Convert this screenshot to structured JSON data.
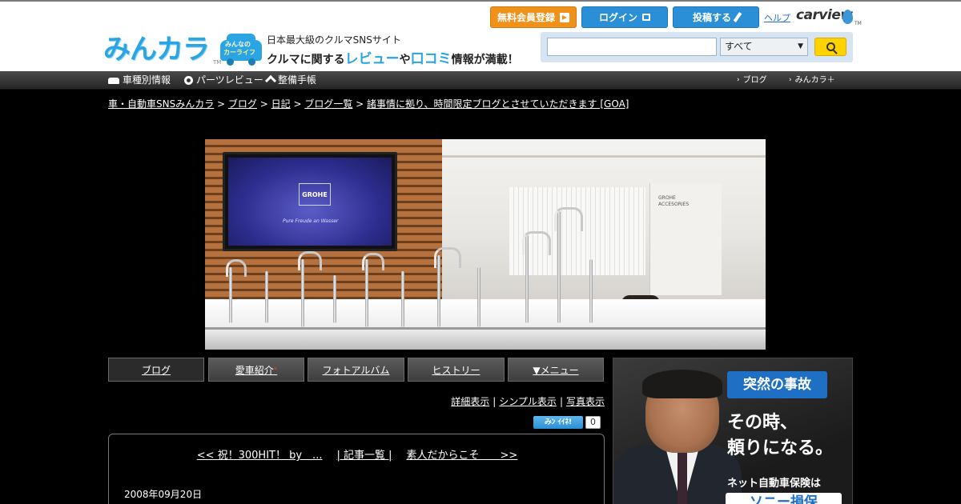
{
  "header": {
    "logo_text": "みんカラ",
    "logo_tm": "TM",
    "carlife_line1": "みんなの",
    "carlife_line2": "カーライフ",
    "tagline1": "日本最大級のクルマSNSサイト",
    "tagline2_parts": [
      "クルマに関する",
      "レビュー",
      "や",
      "口コミ",
      "情報が満載！"
    ],
    "register_label": "無料会員登録",
    "login_label": "ログイン",
    "post_label": "投稿する",
    "help_label": "ヘルプ",
    "carview_logo": "carview",
    "carview_tm": "TM"
  },
  "search": {
    "placeholder": "",
    "value": "",
    "select_value": "すべて"
  },
  "nav": {
    "left": [
      "車種別情報",
      "パーツレビュー",
      "整備手帳"
    ],
    "right": [
      "ブログ",
      "みんカラ＋"
    ]
  },
  "breadcrumb": [
    "車・自動車SNSみんカラ",
    "ブログ",
    "日記",
    "ブログ一覧",
    "諸事情に拠り、時間限定ブログとさせていただきます [GOA]"
  ],
  "breadcrumb_sep": " > ",
  "hero": {
    "tv_logo": "GROHE",
    "tv_sub": "Pure Freude an Wasser",
    "panel_text1": "GROHE",
    "panel_text2": "ACCESORIES"
  },
  "tabs": [
    {
      "label": "ブログ"
    },
    {
      "label": "愛車紹介"
    },
    {
      "label": "フォトアルバム"
    },
    {
      "label": "ヒストリー"
    },
    {
      "label": "▼メニュー"
    }
  ],
  "tab_star": "*",
  "view_links": [
    "詳細表示",
    "シンプル表示",
    "写真表示"
  ],
  "view_sep": "|",
  "like": {
    "label": "ｲｲﾈ!",
    "icon": "みﾝ",
    "count": "0"
  },
  "post": {
    "prev": "<< 祝！300HIT！ by　...",
    "list": "| 記事一覧 |",
    "next": "素人だからこそ　　>>",
    "date": "2008年09月20日"
  },
  "ad": {
    "badge": "突然の事故",
    "line1": "その時、",
    "line2": "頼りになる。",
    "sub": "ネット自動車保険は",
    "brand": "ソニー損保"
  },
  "colors": {
    "accent_blue": "#2a8fd6",
    "register_orange": "#f0911a",
    "search_yellow": "#ffd200"
  },
  "icons": {
    "register": "arrow-box-icon",
    "login": "lock-icon",
    "post": "pen-icon",
    "search": "search-icon",
    "car": "car-icon",
    "parts": "gear-icon",
    "maintenance": "wrench-icon",
    "chevron": "chevron-right-icon"
  }
}
